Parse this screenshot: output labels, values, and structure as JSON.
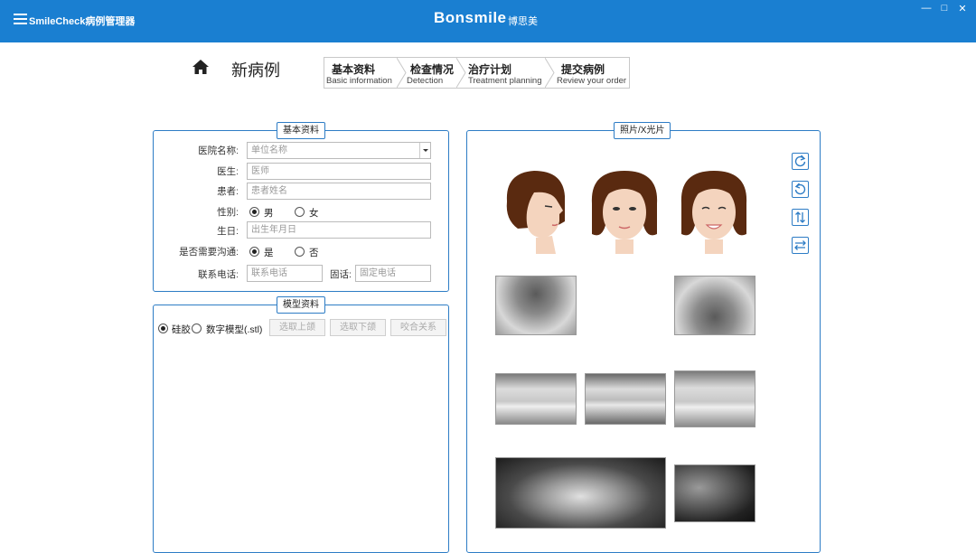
{
  "titlebar": {
    "app_title": "SmileCheck病例管理器",
    "brand": "Bonsmile",
    "brand_sub": "博思美",
    "win_min": "—",
    "win_max": "□",
    "win_close": "✕"
  },
  "page": {
    "title": "新病例"
  },
  "steps": [
    {
      "title": "基本资料",
      "sub": "Basic information"
    },
    {
      "title": "检查情况",
      "sub": "Detection"
    },
    {
      "title": "治疗计划",
      "sub": "Treatment planning"
    },
    {
      "title": "提交病例",
      "sub": "Review your order"
    }
  ],
  "basic": {
    "legend": "基本资料",
    "hospital_label": "医院名称:",
    "hospital_placeholder": "单位名称",
    "doctor_label": "医生:",
    "doctor_placeholder": "医师",
    "patient_label": "患者:",
    "patient_placeholder": "患者姓名",
    "gender_label": "性别:",
    "gender_male": "男",
    "gender_female": "女",
    "birthday_label": "生日:",
    "birthday_placeholder": "出生年月日",
    "communicate_label": "是否需要沟通:",
    "communicate_yes": "是",
    "communicate_no": "否",
    "phone_label": "联系电话:",
    "phone_placeholder": "联系电话",
    "landline_label": "固话:",
    "landline_placeholder": "固定电话"
  },
  "model": {
    "legend": "模型资料",
    "silicone": "硅胶",
    "digital": "数字模型(.stl)",
    "upper_btn": "选取上颌",
    "lower_btn": "选取下颌",
    "bite_btn": "咬合关系"
  },
  "photos": {
    "legend": "照片/X光片",
    "tools": [
      "rotate-ccw-icon",
      "rotate-cw-icon",
      "flip-vertical-icon",
      "flip-horizontal-icon"
    ]
  },
  "colors": {
    "accent": "#1a7fd1",
    "panel_border": "#2d7cc5"
  }
}
